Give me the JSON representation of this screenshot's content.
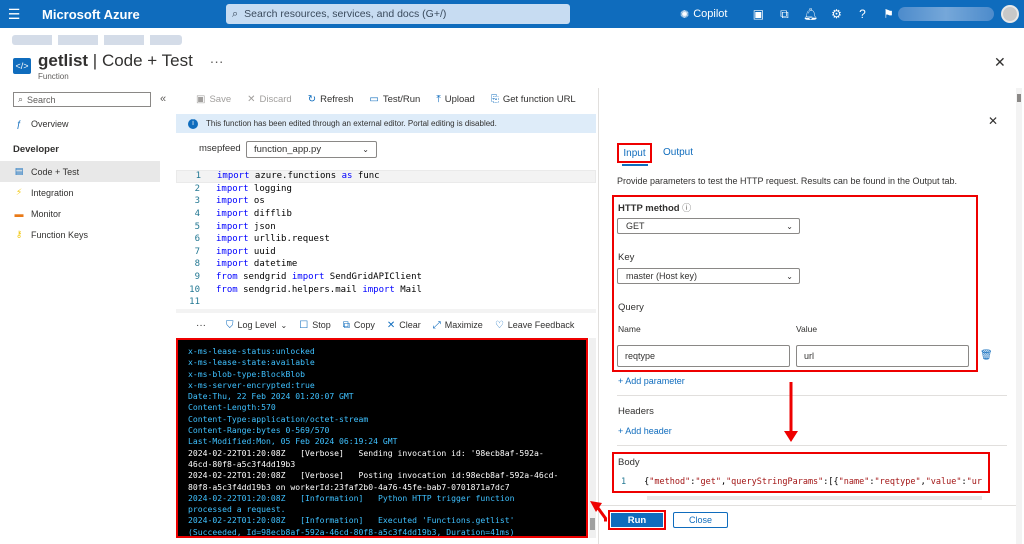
{
  "topbar": {
    "brand": "Microsoft Azure",
    "search_placeholder": "Search resources, services, and docs (G+/)",
    "copilot_label": "Copilot"
  },
  "header": {
    "title_name": "getlist",
    "title_section": "Code + Test",
    "subtitle": "Function",
    "more": "···"
  },
  "sidebar": {
    "search_placeholder": "Search",
    "overview": "Overview",
    "section": "Developer",
    "items": [
      {
        "label": "Code + Test",
        "icon": "code-icon",
        "color": "#0f6cbd"
      },
      {
        "label": "Integration",
        "icon": "lightning-icon",
        "color": "#f2c811"
      },
      {
        "label": "Monitor",
        "icon": "monitor-icon",
        "color": "#e97a18"
      },
      {
        "label": "Function Keys",
        "icon": "key-icon",
        "color": "#f2c811"
      }
    ]
  },
  "toolbar": {
    "save": "Save",
    "discard": "Discard",
    "refresh": "Refresh",
    "test_run": "Test/Run",
    "upload": "Upload",
    "get_url": "Get function URL"
  },
  "info_message": "This function has been edited through an external editor. Portal editing is disabled.",
  "editor": {
    "app_name": "msepfeed",
    "file": "function_app.py",
    "lines": [
      {
        "n": "1",
        "kw": "import",
        "rest": " azure.functions ",
        "kw2": "as",
        "rest2": " func"
      },
      {
        "n": "2",
        "kw": "import",
        "rest": " logging",
        "kw2": "",
        "rest2": ""
      },
      {
        "n": "3",
        "kw": "import",
        "rest": " os",
        "kw2": "",
        "rest2": ""
      },
      {
        "n": "4",
        "kw": "import",
        "rest": " difflib",
        "kw2": "",
        "rest2": ""
      },
      {
        "n": "5",
        "kw": "import",
        "rest": " json",
        "kw2": "",
        "rest2": ""
      },
      {
        "n": "6",
        "kw": "import",
        "rest": " urllib.request",
        "kw2": "",
        "rest2": ""
      },
      {
        "n": "7",
        "kw": "import",
        "rest": " uuid",
        "kw2": "",
        "rest2": ""
      },
      {
        "n": "8",
        "kw": "import",
        "rest": " datetime",
        "kw2": "",
        "rest2": ""
      },
      {
        "n": "9",
        "kw": "from",
        "rest": " sendgrid ",
        "kw2": "import",
        "rest2": " SendGridAPIClient"
      },
      {
        "n": "10",
        "kw": "from",
        "rest": " sendgrid.helpers.mail ",
        "kw2": "import",
        "rest2": " Mail"
      },
      {
        "n": "11",
        "kw": "",
        "rest": "",
        "kw2": "",
        "rest2": ""
      }
    ]
  },
  "logbar": {
    "more": "···",
    "log_level": "Log Level",
    "stop": "Stop",
    "copy": "Copy",
    "clear": "Clear",
    "maximize": "Maximize",
    "feedback": "Leave Feedback"
  },
  "console_lines": [
    {
      "text": "x-ms-lease-status:unlocked",
      "color": "cyan"
    },
    {
      "text": "x-ms-lease-state:available",
      "color": "cyan"
    },
    {
      "text": "x-ms-blob-type:BlockBlob",
      "color": "cyan"
    },
    {
      "text": "x-ms-server-encrypted:true",
      "color": "cyan"
    },
    {
      "text": "Date:Thu, 22 Feb 2024 01:20:07 GMT",
      "color": "cyan"
    },
    {
      "text": "Content-Length:570",
      "color": "cyan"
    },
    {
      "text": "Content-Type:application/octet-stream",
      "color": "cyan"
    },
    {
      "text": "Content-Range:bytes 0-569/570",
      "color": "cyan"
    },
    {
      "text": "Last-Modified:Mon, 05 Feb 2024 06:19:24 GMT",
      "color": "cyan"
    },
    {
      "text": "2024-02-22T01:20:08Z   [Verbose]   Sending invocation id: '98ecb8af-592a-",
      "color": "white"
    },
    {
      "text": "46cd-80f8-a5c3f4dd19b3",
      "color": "white"
    },
    {
      "text": "2024-02-22T01:20:08Z   [Verbose]   Posting invocation id:98ecb8af-592a-46cd-",
      "color": "white"
    },
    {
      "text": "80f8-a5c3f4dd19b3 on workerId:23faf2b0-4a76-45fe-bab7-0701871a7dc7",
      "color": "white"
    },
    {
      "text": "2024-02-22T01:20:08Z   [Information]   Python HTTP trigger function",
      "color": "cyan"
    },
    {
      "text": "processed a request.",
      "color": "cyan"
    },
    {
      "text": "2024-02-22T01:20:08Z   [Information]   Executed 'Functions.getlist'",
      "color": "cyan"
    },
    {
      "text": "(Succeeded, Id=98ecb8af-592a-46cd-80f8-a5c3f4dd19b3, Duration=41ms)",
      "color": "cyan"
    }
  ],
  "panel": {
    "tab_input": "Input",
    "tab_output": "Output",
    "description": "Provide parameters to test the HTTP request. Results can be found in the Output tab.",
    "http_method_label": "HTTP method",
    "http_method_value": "GET",
    "key_label": "Key",
    "key_value": "master (Host key)",
    "query_label": "Query",
    "col_name": "Name",
    "col_value": "Value",
    "param_name": "reqtype",
    "param_value": "url",
    "add_parameter": "+ Add parameter",
    "headers_label": "Headers",
    "add_header": "+ Add header",
    "body_label": "Body",
    "body_line_number": "1",
    "run": "Run",
    "close": "Close"
  },
  "accent": "#0f6cbd",
  "highlight": "#e00000"
}
